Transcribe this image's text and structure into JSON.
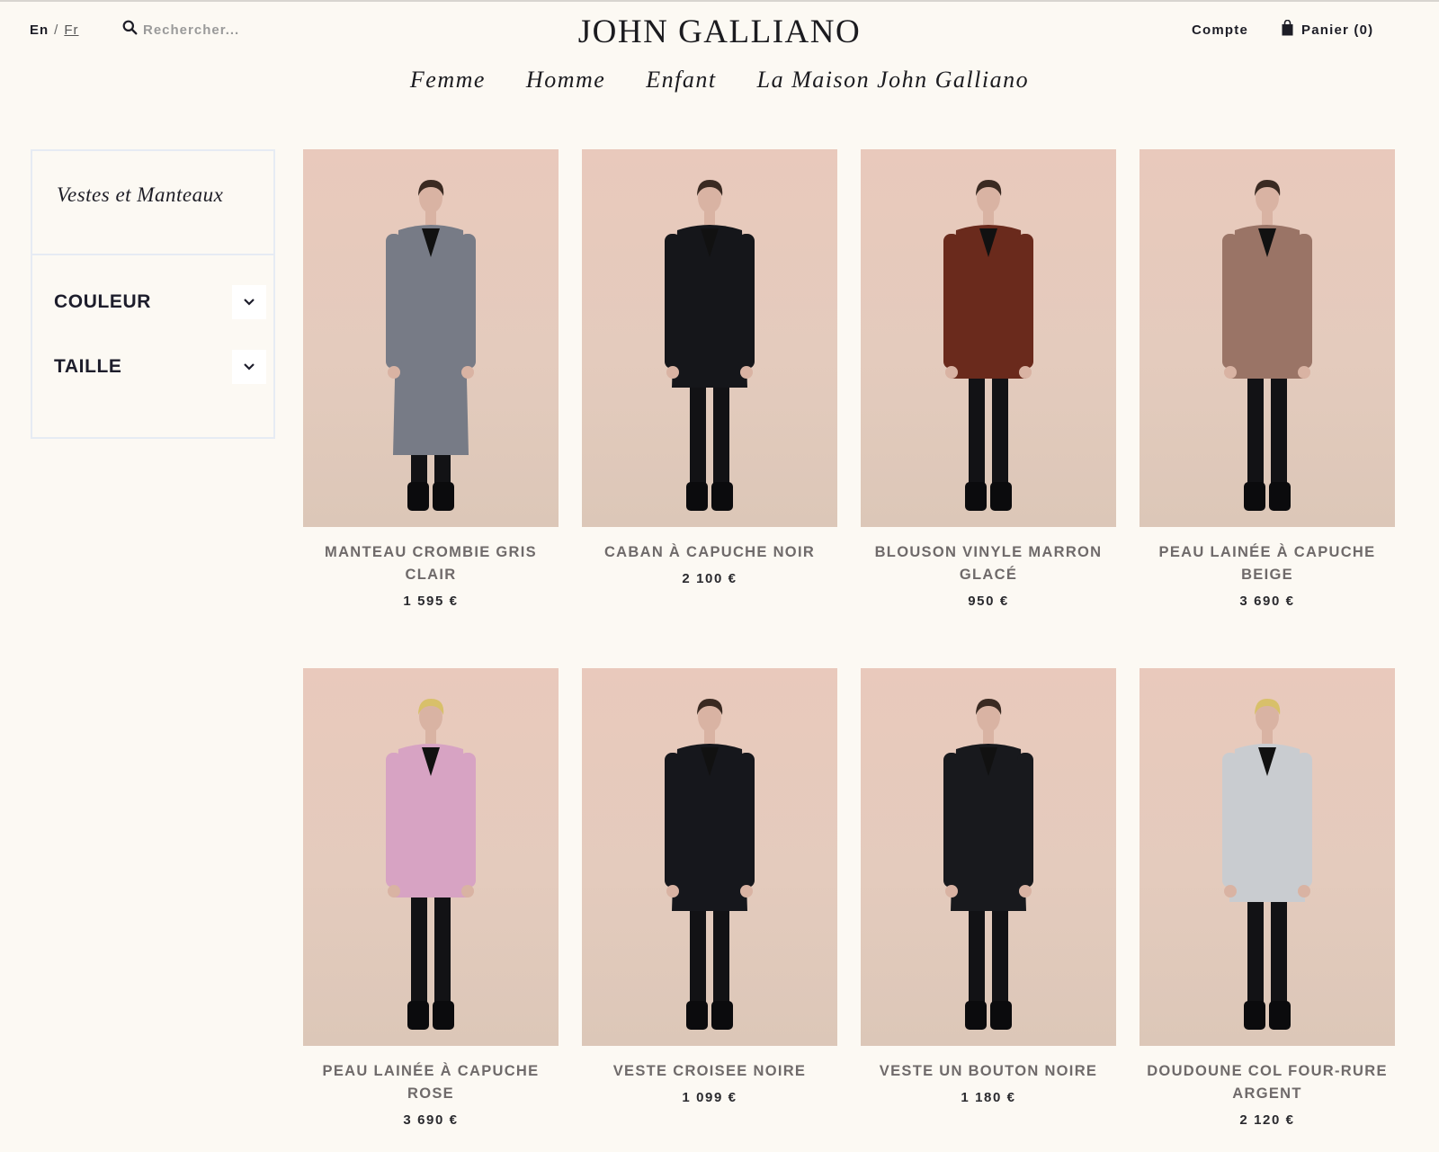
{
  "header": {
    "lang_en": "En",
    "lang_sep": "/",
    "lang_fr": "Fr",
    "search_placeholder": "Rechercher...",
    "logo": "JOHN GALLIANO",
    "account": "Compte",
    "cart": "Panier (0)"
  },
  "nav": [
    "Femme",
    "Homme",
    "Enfant",
    "La Maison John Galliano"
  ],
  "sidebar": {
    "category": "Vestes et Manteaux",
    "filters": [
      "COULEUR",
      "TAILLE"
    ]
  },
  "products": [
    {
      "name": "MANTEAU CROMBIE GRIS CLAIR",
      "price": "1 595 €",
      "coat_color": "#777b86"
    },
    {
      "name": "CABAN À CAPUCHE NOIR",
      "price": "2 100 €",
      "coat_color": "#15161a"
    },
    {
      "name": "BLOUSON VINYLE MARRON GLACÉ",
      "price": "950 €",
      "coat_color": "#6a2a1c"
    },
    {
      "name": "PEAU LAINÉE À CAPUCHE BEIGE",
      "price": "3 690 €",
      "coat_color": "#9a7466"
    },
    {
      "name": "PEAU LAINÉE À CAPUCHE ROSE",
      "price": "3 690 €",
      "coat_color": "#d7a3c3"
    },
    {
      "name": "VESTE CROISEE NOIRE",
      "price": "1 099 €",
      "coat_color": "#16171c"
    },
    {
      "name": "VESTE UN BOUTON NOIRE",
      "price": "1 180 €",
      "coat_color": "#18191d"
    },
    {
      "name": "DOUDOUNE COL FOUR-RURE ARGENT",
      "price": "2 120 €",
      "coat_color": "#c9ccd0"
    }
  ]
}
